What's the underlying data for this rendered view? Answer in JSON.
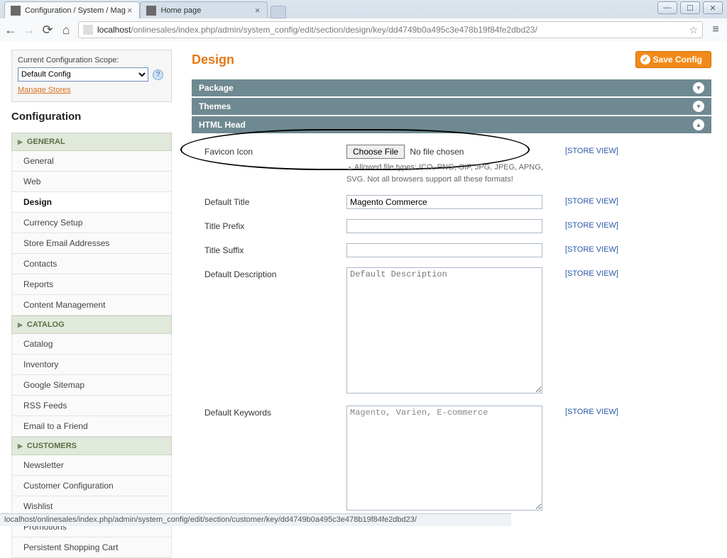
{
  "browser": {
    "tabs": [
      {
        "title": "Configuration / System / Mag"
      },
      {
        "title": "Home page"
      }
    ],
    "url_host": "localhost",
    "url_path": "/onlinesales/index.php/admin/system_config/edit/section/design/key/dd4749b0a495c3e478b19f84fe2dbd23/",
    "status_url": "localhost/onlinesales/index.php/admin/system_config/edit/section/customer/key/dd4749b0a495c3e478b19f84fe2dbd23/"
  },
  "scope": {
    "label": "Current Configuration Scope:",
    "value": "Default Config",
    "manage_link": "Manage Stores"
  },
  "sidebar_title": "Configuration",
  "nav": {
    "groups": [
      {
        "label": "GENERAL",
        "items": [
          "General",
          "Web",
          "Design",
          "Currency Setup",
          "Store Email Addresses",
          "Contacts",
          "Reports",
          "Content Management"
        ],
        "active": "Design"
      },
      {
        "label": "CATALOG",
        "items": [
          "Catalog",
          "Inventory",
          "Google Sitemap",
          "RSS Feeds",
          "Email to a Friend"
        ]
      },
      {
        "label": "CUSTOMERS",
        "items": [
          "Newsletter",
          "Customer Configuration",
          "Wishlist",
          "Promotions",
          "Persistent Shopping Cart"
        ]
      }
    ]
  },
  "page": {
    "title": "Design",
    "save_label": "Save Config",
    "sections": [
      {
        "title": "Package",
        "open": false
      },
      {
        "title": "Themes",
        "open": false
      },
      {
        "title": "HTML Head",
        "open": true
      }
    ],
    "scope_tag": "[STORE VIEW]",
    "fields": {
      "favicon": {
        "label": "Favicon Icon",
        "choose_btn": "Choose File",
        "status": "No file chosen",
        "note": "Allowed file types: ICO, PNG, GIF, JPG, JPEG, APNG, SVG. Not all browsers support all these formats!"
      },
      "default_title": {
        "label": "Default Title",
        "value": "Magento Commerce"
      },
      "title_prefix": {
        "label": "Title Prefix",
        "value": ""
      },
      "title_suffix": {
        "label": "Title Suffix",
        "value": ""
      },
      "default_description": {
        "label": "Default Description",
        "value": "Default Description"
      },
      "default_keywords": {
        "label": "Default Keywords",
        "value": "Magento, Varien, E-commerce"
      }
    }
  }
}
